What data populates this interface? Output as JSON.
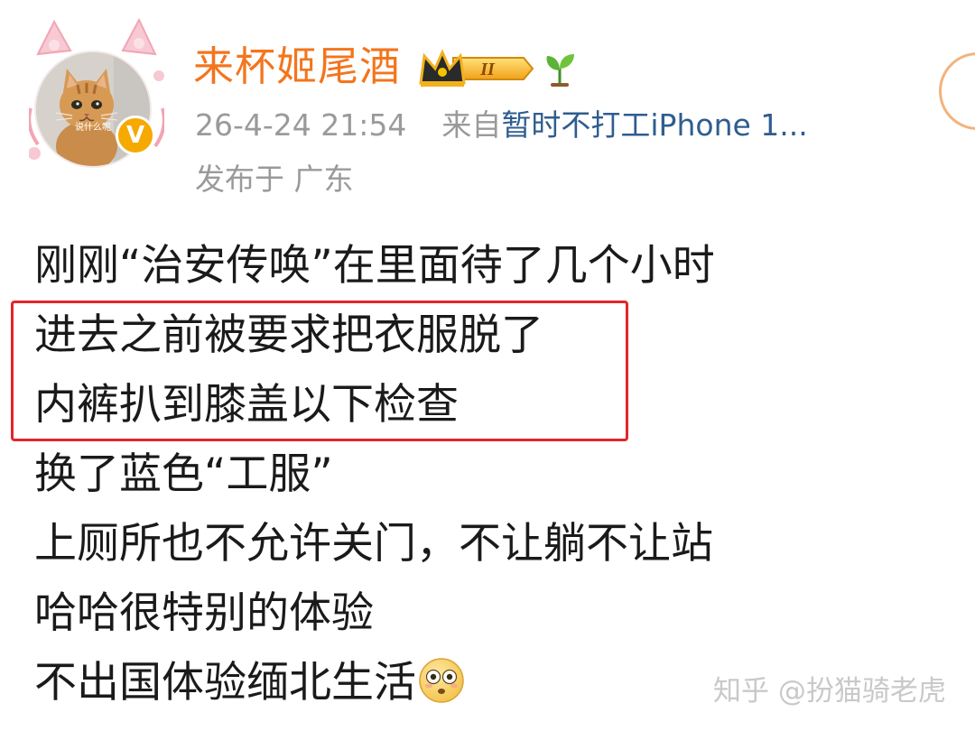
{
  "header": {
    "username": "来杯姬尾酒",
    "avatar_caption": "说什么呢",
    "crown_badge_level": "II",
    "timestamp": "26-4-24 21:54",
    "source_prefix": "来自",
    "source_device": "暂时不打工iPhone 1...",
    "location": "发布于 广东"
  },
  "post": {
    "lines": [
      "刚刚“治安传唤”在里面待了几个小时",
      "进去之前被要求把衣服脱了",
      "内裤扒到膝盖以下检查",
      "换了蓝色“工服”",
      "上厕所也不允许关门，不让躺不让站",
      "哈哈很特别的体验",
      "不出国体验缅北生活"
    ],
    "highlighted_lines": [
      1,
      2
    ],
    "trailing_emoji": "flushed-face"
  },
  "watermark": "知乎 @扮猫骑老虎",
  "colors": {
    "username": "#f3751d",
    "device_link": "#2f5d8f",
    "meta": "#9a9a9a",
    "highlight_border": "#e3262b",
    "verified_badge": "#f6a900",
    "text": "#1a1a1a"
  }
}
